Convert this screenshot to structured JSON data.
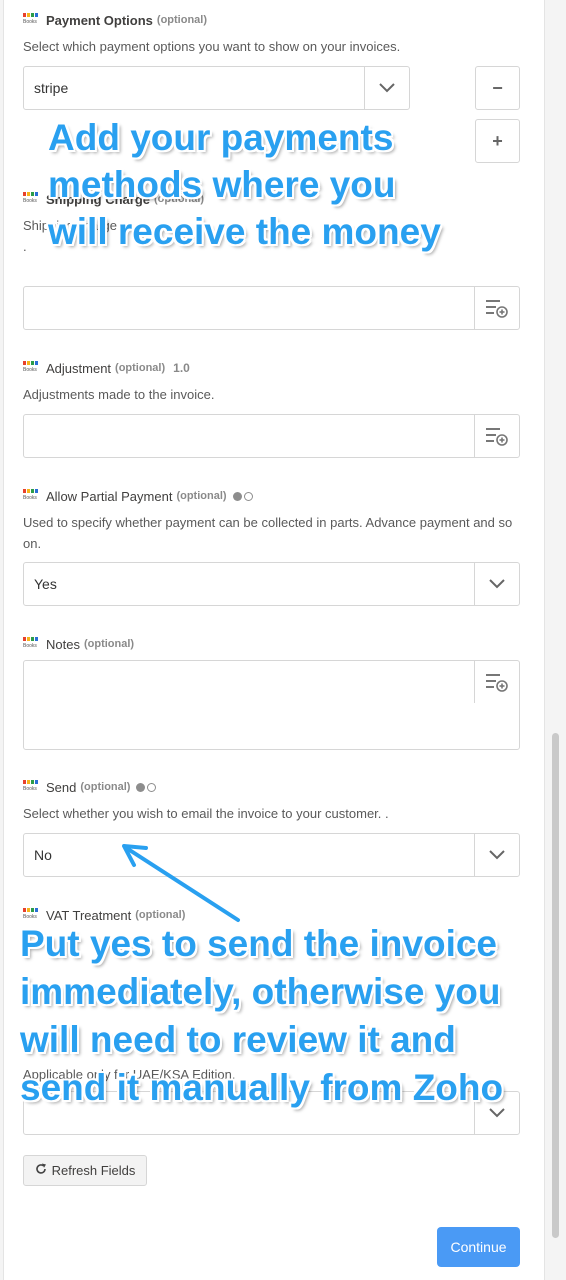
{
  "fields": {
    "payment_options": {
      "label": "Payment Options",
      "optional": "(optional)",
      "help": "Select which payment options you want to show on your invoices.",
      "value": "stripe",
      "remove_label": "−",
      "add_label": "+"
    },
    "shipping_charge": {
      "label": "Shipping Charge",
      "optional": "(optional)",
      "help": "Shipping charge",
      "help2": "."
    },
    "adjustment": {
      "label": "Adjustment",
      "optional": "(optional)",
      "version": "1.0",
      "help": "Adjustments made to the invoice."
    },
    "allow_partial_payment": {
      "label": "Allow Partial Payment",
      "optional": "(optional)",
      "help": "Used to specify whether payment can be collected in parts. Advance payment and so on.",
      "value": "Yes"
    },
    "notes": {
      "label": "Notes",
      "optional": "(optional)"
    },
    "send": {
      "label": "Send",
      "optional": "(optional)",
      "help": "Select whether you wish to email the invoice to your customer. .",
      "value": "No"
    },
    "vat_treatment": {
      "label": "VAT Treatment",
      "optional": "(optional)",
      "help": "Applicable only for UAE/KSA Edition."
    }
  },
  "buttons": {
    "refresh": "Refresh Fields",
    "continue": "Continue"
  },
  "annotations": {
    "top": [
      "Add your payments",
      "methods where you",
      "will receive the money"
    ],
    "bottom": [
      "Put yes to send the invoice",
      "immediately, otherwise you",
      "will need to review it and",
      "send it manually from Zoho"
    ]
  },
  "logo_text": "Books",
  "colors": {
    "accent": "#4a9af5",
    "annotation": "#29a0f0"
  }
}
